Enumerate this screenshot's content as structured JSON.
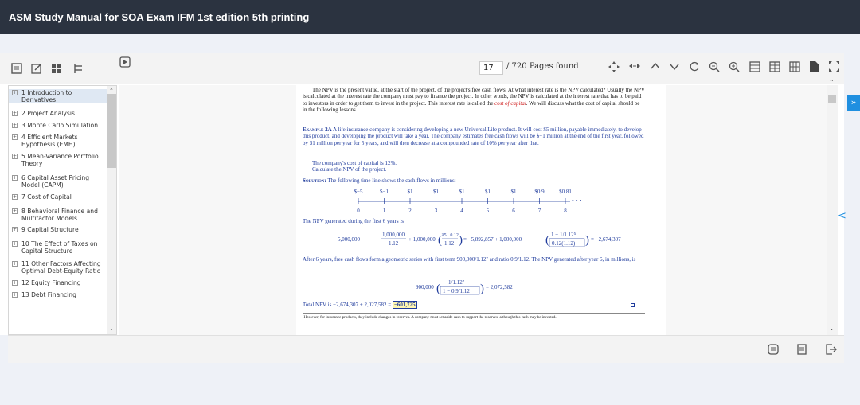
{
  "title": "ASM Study Manual for SOA Exam IFM 1st edition 5th printing",
  "toolbar": {
    "page_number": "17",
    "page_count": "/ 720 Pages found",
    "left_icons": [
      "bookmark-list-icon",
      "edit-note-icon",
      "thumbnails-grid-icon",
      "outline-tree-icon"
    ],
    "play_icon": "play-icon",
    "right_icons": [
      "fit-width-icon",
      "fit-page-icon",
      "previous-page-icon",
      "next-page-icon",
      "rotate-icon",
      "zoom-out-icon",
      "zoom-in-icon",
      "single-page-icon",
      "two-page-icon",
      "grid-view-icon",
      "document-icon",
      "fullscreen-icon"
    ]
  },
  "toc": [
    {
      "label": "1 Introduction to Derivatives",
      "selected": true
    },
    {
      "label": "2 Project Analysis",
      "selected": false
    },
    {
      "label": "3 Monte Carlo Simulation",
      "selected": false
    },
    {
      "label": "4 Efficient Markets Hypothesis (EMH)",
      "selected": false
    },
    {
      "label": "5 Mean-Variance Portfolio Theory",
      "selected": false
    },
    {
      "label": "6 Capital Asset Pricing Model (CAPM)",
      "selected": false
    },
    {
      "label": "7 Cost of Capital",
      "selected": false
    },
    {
      "label": "8 Behavioral Finance and Multifactor Models",
      "selected": false
    },
    {
      "label": "9 Capital Structure",
      "selected": false
    },
    {
      "label": "10 The Effect of Taxes on Capital Structure",
      "selected": false
    },
    {
      "label": "11 Other Factors Affecting Optimal Debt-Equity Ratio",
      "selected": false
    },
    {
      "label": "12 Equity Financing",
      "selected": false
    },
    {
      "label": "13 Debt Financing",
      "selected": false
    }
  ],
  "doc": {
    "para1_a": "The NPV is the present value, at the start of the project, of the project's free cash flows. At what interest rate is the NPV calculated? Usually the NPV is calculated at the interest rate the company must pay to finance the project. In other words, the NPV is calculated at the interest rate that has to be paid to investors in order to get them to invest in the project. This interest rate is called the",
    "para1_term": "cost of capital",
    "para1_b": ". We will discuss what the cost of capital should be in the following lessons.",
    "example_label": "Example 2A",
    "example_text": "A life insurance company is considering developing a new Universal Life product. It will cost $5 million, payable immediately, to develop this product, and developing the product will take a year. The company estimates free cash flows will be $−1 million at the end of the first year, followed by $1 million per year for 5 years, and will then decrease at a compounded rate of 10% per year after that.",
    "example_line2": "The company's cost of capital is 12%.",
    "example_line3": "Calculate the NPV of the project.",
    "solution_label": "Solution:",
    "solution_text": "The following time line shows the cash flows in millions:",
    "cashflows": [
      "$−5",
      "$−1",
      "$1",
      "$1",
      "$1",
      "$1",
      "$1",
      "$0.9",
      "$0.81"
    ],
    "times": [
      "0",
      "1",
      "2",
      "3",
      "4",
      "5",
      "6",
      "7",
      "8"
    ],
    "npv_text": "The NPV generated during the first 6 years is",
    "eq1_a": "−5,000,000 −",
    "eq1_frac_num": "1,000,000",
    "eq1_frac_den": "1.12",
    "eq1_b": "+ 1,000,000",
    "eq1_ann_num": "a̅5⃒0.12",
    "eq1_ann_den": "1.12",
    "eq1_c": "= −5,892,857 + 1,000,000",
    "eq1_d_num": "1 − 1/1.12⁵",
    "eq1_d_den": "0.12(1.12)",
    "eq1_e": "= −2,674,307",
    "after_text": "After 6 years, free cash flows form a geometric series with first term 900,000/1.12⁷ and ratio 0.9/1.12. The NPV generated after year 6, in millions, is",
    "eq2_a": "900,000",
    "eq2_num": "1/1.12⁷",
    "eq2_den": "1 − 0.9/1.12",
    "eq2_b": "= 2,072,582",
    "total_a": "Total NPV is −2,674,307 + 2,027,582 =",
    "total_box": "−601,725",
    "footnote": "¹However, for insurance products, they include changes in reserves. A company must set aside cash to support the reserves, although this cash may be invested."
  },
  "bottom_icons": [
    "notes-icon",
    "document-list-icon",
    "exit-icon"
  ],
  "side_tab": "»",
  "side_arrow": "<"
}
